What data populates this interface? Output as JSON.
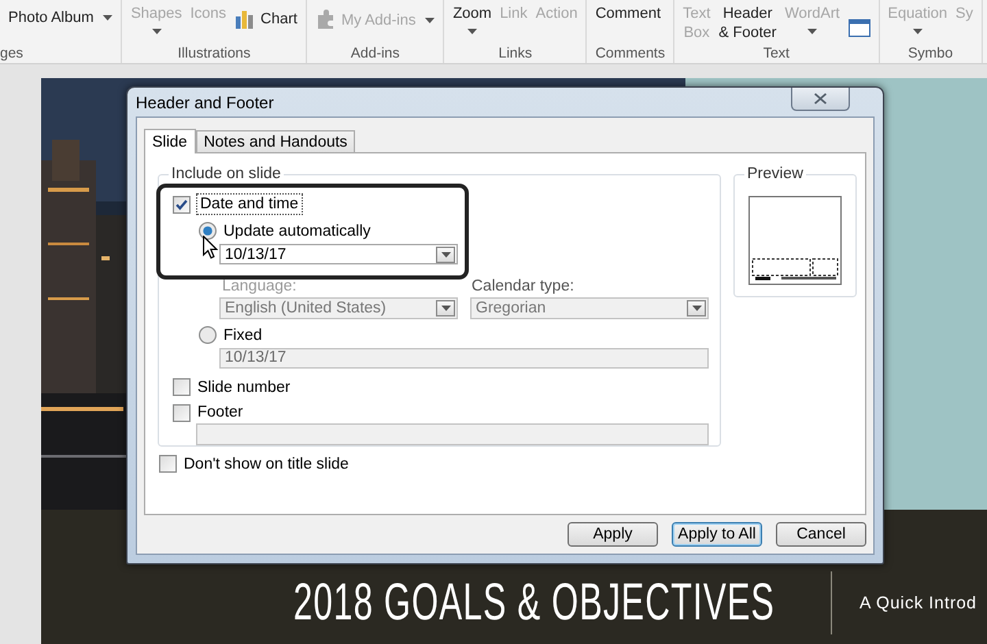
{
  "ribbon": {
    "groups": [
      {
        "label": "ges",
        "items": [
          {
            "label": "Photo Album",
            "kind": "small",
            "caret": true,
            "disabled": false
          }
        ]
      },
      {
        "label": "Illustrations",
        "items": [
          {
            "label": "Shapes",
            "kind": "large",
            "caret": true,
            "disabled": true
          },
          {
            "label": "Icons",
            "kind": "large",
            "caret": false,
            "disabled": true
          },
          {
            "label": "Chart",
            "kind": "chart",
            "caret": false,
            "disabled": false
          }
        ]
      },
      {
        "label": "Add-ins",
        "items": [
          {
            "label": "My Add-ins",
            "kind": "addins",
            "caret": true,
            "disabled": true
          }
        ]
      },
      {
        "label": "Links",
        "items": [
          {
            "label": "Zoom",
            "kind": "large",
            "caret": true,
            "disabled": false
          },
          {
            "label": "Link",
            "kind": "large",
            "caret": false,
            "disabled": true
          },
          {
            "label": "Action",
            "kind": "large",
            "caret": false,
            "disabled": true
          }
        ]
      },
      {
        "label": "Comments",
        "items": [
          {
            "label": "Comment",
            "kind": "large",
            "caret": false,
            "disabled": false
          }
        ]
      },
      {
        "label": "Text",
        "items": [
          {
            "label": "Text\nBox",
            "kind": "large",
            "caret": false,
            "disabled": true
          },
          {
            "label": "Header\n& Footer",
            "kind": "large",
            "caret": false,
            "disabled": false
          },
          {
            "label": "WordArt",
            "kind": "large",
            "caret": true,
            "disabled": true
          },
          {
            "kind": "window"
          }
        ]
      },
      {
        "label": "Symbo",
        "items": [
          {
            "label": "Equation",
            "kind": "large",
            "caret": true,
            "disabled": true
          },
          {
            "label": "Sy",
            "kind": "large",
            "caret": false,
            "disabled": true
          }
        ]
      }
    ]
  },
  "slide": {
    "title": "2018 GOALS & OBJECTIVES",
    "subtitle": "A Quick Introd"
  },
  "dialog": {
    "title": "Header and Footer",
    "tabs": [
      {
        "label": "Slide",
        "selected": true
      },
      {
        "label": "Notes and Handouts",
        "selected": false
      }
    ],
    "include_label": "Include on slide",
    "date_time": {
      "label": "Date and time",
      "checked": true
    },
    "update_automatically": {
      "label": "Update automatically",
      "selected": true,
      "value": "10/13/17"
    },
    "language": {
      "label": "Language:",
      "value": "English (United States)",
      "disabled": true
    },
    "calendar_type": {
      "label": "Calendar type:",
      "value": "Gregorian",
      "disabled": true
    },
    "fixed": {
      "label": "Fixed",
      "selected": false,
      "value": "10/13/17"
    },
    "slide_number": {
      "label": "Slide number",
      "checked": false
    },
    "footer": {
      "label": "Footer",
      "checked": false
    },
    "dont_show_on_title_slide": {
      "label": "Don't show on title slide",
      "checked": false
    },
    "preview_label": "Preview",
    "buttons": [
      {
        "label": "Apply",
        "default": false
      },
      {
        "label": "Apply to All",
        "default": true
      },
      {
        "label": "Cancel",
        "default": false
      }
    ]
  }
}
